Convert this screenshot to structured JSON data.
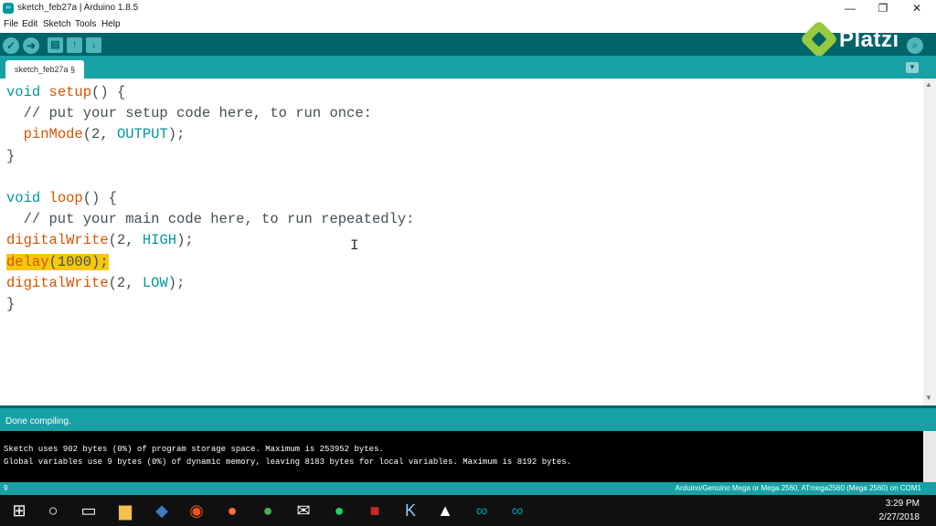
{
  "window": {
    "app_icon": "arduino-icon",
    "title": "sketch_feb27a | Arduino 1.8.5",
    "minimize_label": "—",
    "restore_label": "❐",
    "close_label": "✕"
  },
  "menu": {
    "items": [
      "File",
      "Edit",
      "Sketch",
      "Tools",
      "Help"
    ]
  },
  "toolbar": {
    "buttons": [
      {
        "icon": "verify-icon",
        "glyph": "✓"
      },
      {
        "icon": "upload-icon",
        "glyph": "➜"
      },
      {
        "icon": "new-icon",
        "glyph": "▤"
      },
      {
        "icon": "open-icon",
        "glyph": "↑"
      },
      {
        "icon": "save-icon",
        "glyph": "↓"
      }
    ],
    "serial_icon": "serial-monitor-icon",
    "serial_glyph": "⌕"
  },
  "watermark": {
    "brand": "Platzi"
  },
  "tabs": {
    "active_label": "sketch_feb27a §",
    "menu_glyph": "▼"
  },
  "editor": {
    "lines": [
      [
        {
          "t": "void",
          "c": "kw"
        },
        {
          "t": " "
        },
        {
          "t": "setup",
          "c": "fn"
        },
        {
          "t": "() {"
        }
      ],
      [
        {
          "t": "  // put your setup code here, to run once:",
          "c": "cm"
        }
      ],
      [
        {
          "t": "  "
        },
        {
          "t": "pinMode",
          "c": "fn"
        },
        {
          "t": "(2, "
        },
        {
          "t": "OUTPUT",
          "c": "kw"
        },
        {
          "t": ");"
        }
      ],
      [
        {
          "t": "}"
        }
      ],
      [
        {
          "t": ""
        }
      ],
      [
        {
          "t": "void",
          "c": "kw"
        },
        {
          "t": " "
        },
        {
          "t": "loop",
          "c": "fn"
        },
        {
          "t": "() {"
        }
      ],
      [
        {
          "t": "  // put your main code here, to run repeatedly:",
          "c": "cm"
        }
      ],
      [
        {
          "t": "digitalWrite",
          "c": "fn"
        },
        {
          "t": "(2, "
        },
        {
          "t": "HIGH",
          "c": "kw"
        },
        {
          "t": ");"
        }
      ],
      [
        {
          "t": "delay",
          "c": "fn hl"
        },
        {
          "t": "(1000);",
          "c": "hl"
        }
      ],
      [
        {
          "t": "digitalWrite",
          "c": "fn"
        },
        {
          "t": "(2, "
        },
        {
          "t": "LOW",
          "c": "kw"
        },
        {
          "t": ");"
        }
      ],
      [
        {
          "t": "}"
        }
      ]
    ],
    "cursor_glyph": "I"
  },
  "status": {
    "message": "Done compiling."
  },
  "console": {
    "lines": [
      "Sketch uses 902 bytes (0%) of program storage space. Maximum is 253952 bytes.",
      "Global variables use 9 bytes (0%) of dynamic memory, leaving 8183 bytes for local variables. Maximum is 8192 bytes."
    ]
  },
  "footer": {
    "line_number": "9",
    "board": "Arduino/Genuino Mega or Mega 2560, ATmega2560 (Mega 2560) on COM1"
  },
  "taskbar": {
    "apps": [
      {
        "icon": "windows-start-icon",
        "glyph": "⊞",
        "color": "#ffffff"
      },
      {
        "icon": "cortana-icon",
        "glyph": "○",
        "color": "#ffffff"
      },
      {
        "icon": "task-view-icon",
        "glyph": "▭",
        "color": "#ffffff"
      },
      {
        "icon": "file-explorer-icon",
        "glyph": "▆",
        "color": "#f2c14e"
      },
      {
        "icon": "python-icon",
        "glyph": "◆",
        "color": "#3b7bbf"
      },
      {
        "icon": "ubuntu-icon",
        "glyph": "◉",
        "color": "#e95420"
      },
      {
        "icon": "firefox-icon",
        "glyph": "●",
        "color": "#ff7139"
      },
      {
        "icon": "chrome-icon",
        "glyph": "●",
        "color": "#4caf50"
      },
      {
        "icon": "mail-icon",
        "glyph": "✉",
        "color": "#ffffff"
      },
      {
        "icon": "spotify-icon",
        "glyph": "●",
        "color": "#1ed760"
      },
      {
        "icon": "app-red-icon",
        "glyph": "■",
        "color": "#c62828"
      },
      {
        "icon": "app-k-icon",
        "glyph": "K",
        "color": "#90caf9"
      },
      {
        "icon": "photos-icon",
        "glyph": "▲",
        "color": "#ffffff"
      },
      {
        "icon": "arduino-taskbar-icon",
        "glyph": "∞",
        "color": "#00979c"
      },
      {
        "icon": "arduino-taskbar-icon-2",
        "glyph": "∞",
        "color": "#00979c"
      }
    ],
    "time": "3:29 PM",
    "date": "2/27/2018"
  },
  "colors": {
    "toolbar": "#006468",
    "tabsbar": "#17a1a5",
    "keyword": "#00979c",
    "function": "#d35400",
    "highlight": "#f6c70e"
  }
}
